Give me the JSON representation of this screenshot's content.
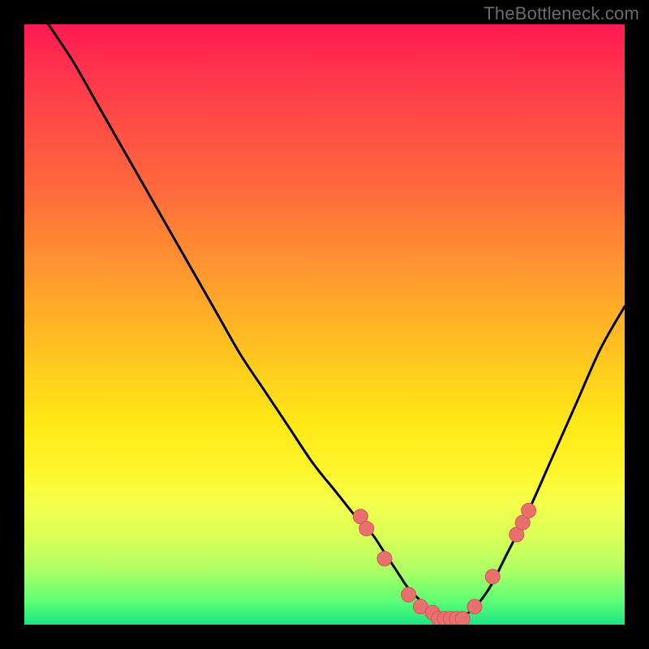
{
  "watermark": "TheBottleneck.com",
  "colors": {
    "frame": "#000000",
    "curve": "#000000",
    "marker_fill": "#e9706d",
    "marker_stroke": "#c85a57"
  },
  "chart_data": {
    "type": "line",
    "title": "",
    "xlabel": "",
    "ylabel": "",
    "xlim": [
      0,
      100
    ],
    "ylim": [
      0,
      100
    ],
    "grid": false,
    "legend": false,
    "note": "Bottleneck-style V curve; y is mismatch % (0 = ideal). Values read from vertical position against full plot height.",
    "series": [
      {
        "name": "curve",
        "x": [
          4,
          8,
          12,
          16,
          20,
          24,
          28,
          32,
          36,
          40,
          44,
          48,
          52,
          56,
          58,
          60,
          62,
          64,
          66,
          68,
          70,
          72,
          74,
          76,
          78,
          80,
          84,
          88,
          92,
          96,
          100
        ],
        "y": [
          100,
          94,
          87,
          80,
          73,
          66,
          59,
          52,
          45,
          39,
          33,
          27,
          22,
          17,
          15,
          12,
          9,
          6,
          4,
          2,
          1,
          1,
          2,
          4,
          7,
          11,
          19,
          28,
          37,
          46,
          53
        ]
      }
    ],
    "markers": {
      "name": "highlighted-points",
      "x": [
        56,
        57,
        60,
        64,
        66,
        68,
        69,
        70,
        71,
        72,
        73,
        75,
        78,
        82,
        83,
        84
      ],
      "y": [
        18,
        16,
        11,
        5,
        3,
        2,
        1,
        1,
        1,
        1,
        1,
        3,
        8,
        15,
        17,
        19
      ]
    }
  }
}
